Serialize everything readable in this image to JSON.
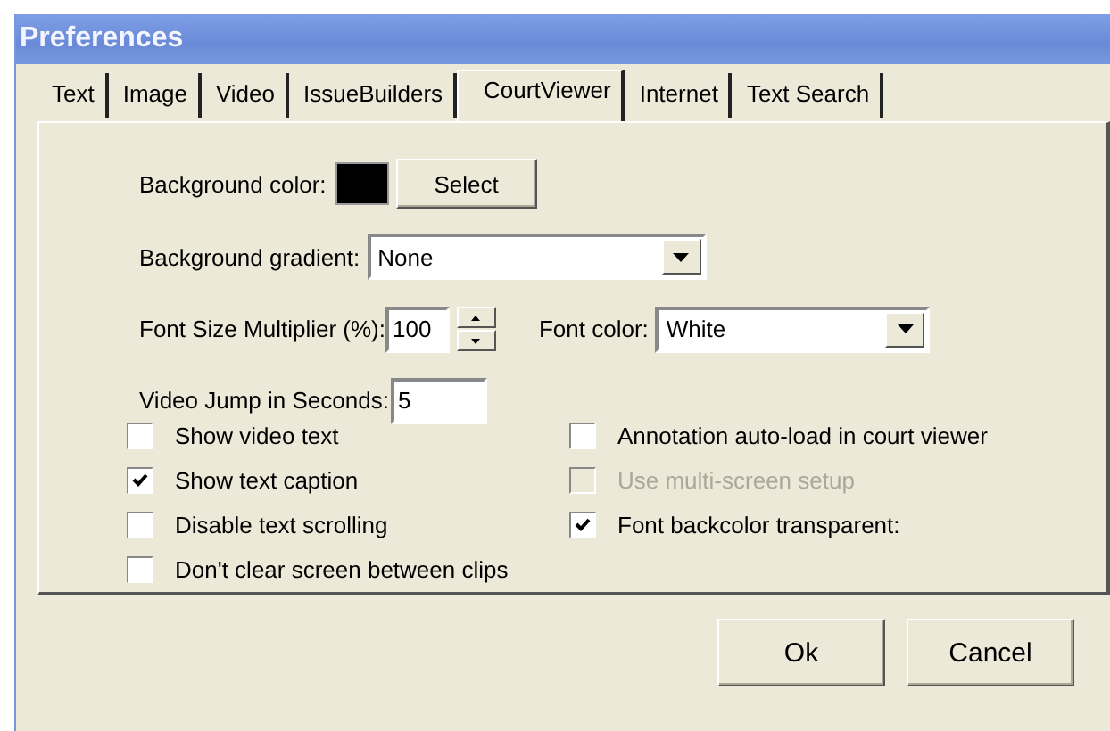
{
  "window": {
    "title": "Preferences"
  },
  "tabs": [
    {
      "label": "Text",
      "selected": false
    },
    {
      "label": "Image",
      "selected": false
    },
    {
      "label": "Video",
      "selected": false
    },
    {
      "label": "IssueBuilders",
      "selected": false
    },
    {
      "label": "CourtViewer",
      "selected": true
    },
    {
      "label": "Internet",
      "selected": false
    },
    {
      "label": "Text Search",
      "selected": false
    }
  ],
  "background_color": {
    "label": "Background color:",
    "color": "#000000",
    "button": "Select"
  },
  "background_gradient": {
    "label": "Background gradient:",
    "value": "None"
  },
  "font_size_multiplier": {
    "label": "Font Size Multiplier (%):",
    "value": "100"
  },
  "font_color": {
    "label": "Font color:",
    "value": "White"
  },
  "video_jump": {
    "label": "Video Jump in Seconds:",
    "value": "5"
  },
  "left_options": [
    {
      "label": "Show video text",
      "checked": false,
      "disabled": false
    },
    {
      "label": "Show text caption",
      "checked": true,
      "disabled": false
    },
    {
      "label": "Disable text scrolling",
      "checked": false,
      "disabled": false
    },
    {
      "label": "Don't clear screen between clips",
      "checked": false,
      "disabled": false
    }
  ],
  "right_options": [
    {
      "label": "Annotation auto-load in court viewer",
      "checked": false,
      "disabled": false
    },
    {
      "label": "Use multi-screen setup",
      "checked": false,
      "disabled": true
    },
    {
      "label": "Font backcolor transparent:",
      "checked": true,
      "disabled": false
    }
  ],
  "buttons": [
    "Ok",
    "Cancel"
  ]
}
